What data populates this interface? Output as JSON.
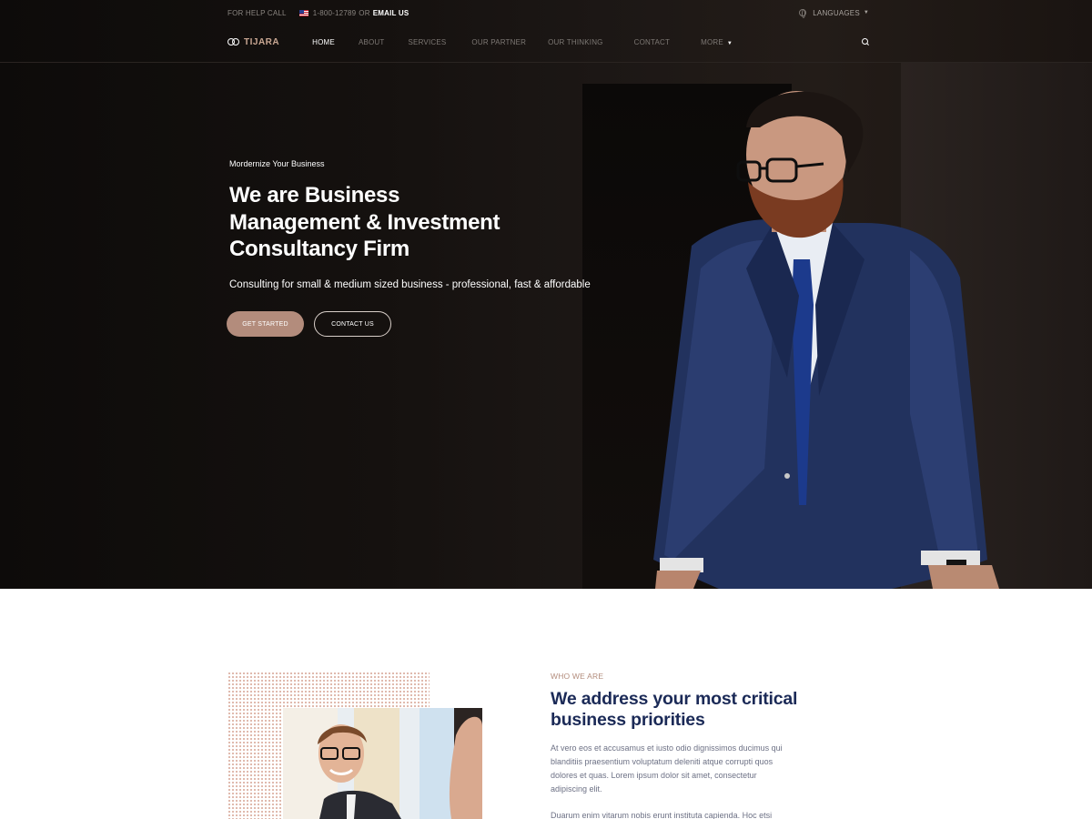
{
  "topbar": {
    "help_label": "FOR HELP CALL",
    "phone": "1-800-12789",
    "or_text": "OR",
    "email_label": "EMAIL US",
    "languages_label": "LANGUAGES"
  },
  "nav": {
    "logo_text": "TIJARA",
    "items": [
      {
        "label": "HOME",
        "active": true
      },
      {
        "label": "ABOUT"
      },
      {
        "label": "SERVICES"
      },
      {
        "label": "OUR PARTNER"
      },
      {
        "label": "OUR THINKING"
      },
      {
        "label": "CONTACT"
      },
      {
        "label": "MORE"
      }
    ]
  },
  "hero": {
    "eyebrow": "Mordernize Your Business",
    "title_line1": "We are Business",
    "title_line2": "Management & Investment",
    "title_line3": "Consultancy Firm",
    "subtitle": "Consulting for small & medium sized business - professional, fast & affordable",
    "primary_button": "GET STARTED",
    "secondary_button": "CONTACT US"
  },
  "about": {
    "label": "WHO WE ARE",
    "title_line1": "We address your most critical",
    "title_line2": "business priorities",
    "paragraph1": "At vero eos et accusamus et iusto odio dignissimos ducimus qui blanditiis praesentium voluptatum deleniti atque corrupti quos dolores et quas. Lorem ipsum dolor sit amet, consectetur adipiscing elit.",
    "paragraph2": "Duarum enim vitarum nobis erunt instituta capienda. Hoc etsi"
  },
  "colors": {
    "accent": "#b38c7c",
    "heading_navy": "#1b2a57",
    "hero_bg": "#15110f"
  },
  "icons": [
    "flag-us-icon",
    "globe-icon",
    "logo-rings-icon",
    "chevron-down-icon",
    "search-icon"
  ]
}
